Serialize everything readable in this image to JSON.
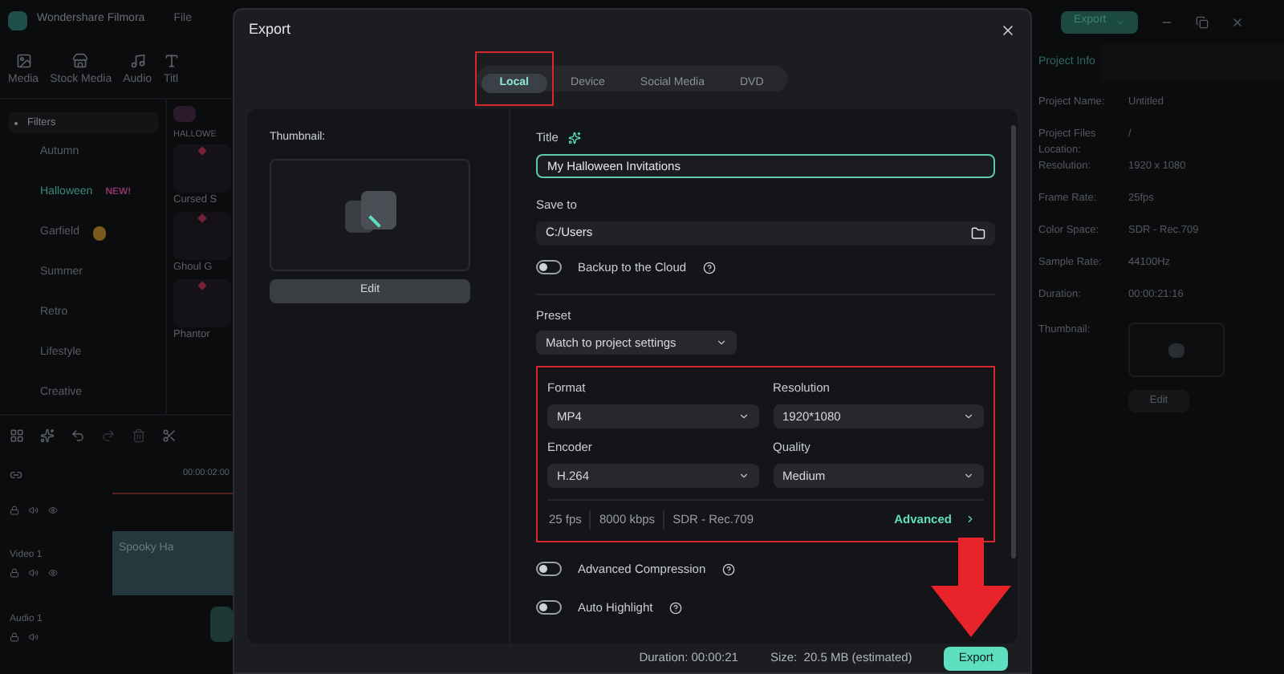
{
  "app": {
    "title": "Wondershare Filmora",
    "menu": [
      "File"
    ],
    "toolbar": [
      {
        "kind": "media",
        "label": "Media"
      },
      {
        "kind": "stock",
        "label": "Stock Media"
      },
      {
        "kind": "audio",
        "label": "Audio"
      },
      {
        "kind": "titles",
        "label": "Titl"
      }
    ],
    "filters": {
      "heading": "Filters",
      "items": [
        {
          "label": "Autumn",
          "selected": false
        },
        {
          "label": "Halloween",
          "selected": true,
          "badge": "NEW!"
        },
        {
          "label": "Garfield",
          "selected": false,
          "sticker": true
        },
        {
          "label": "Summer",
          "selected": false
        },
        {
          "label": "Retro",
          "selected": false
        },
        {
          "label": "Lifestyle",
          "selected": false
        },
        {
          "label": "Creative",
          "selected": false
        }
      ]
    },
    "library": {
      "heading": "HALLOWE",
      "items": [
        "Cursed S",
        "Ghoul G",
        "Phantor"
      ]
    },
    "timeline": {
      "time": "00:00:02:00",
      "tracks": [
        {
          "kind": "video",
          "label": "Video 1",
          "clip": "Spooky Ha"
        },
        {
          "kind": "audio",
          "label": "Audio 1"
        }
      ]
    }
  },
  "header": {
    "export_button": "Export"
  },
  "project_info": {
    "tab": "Project Info",
    "rows": [
      {
        "label": "Project Name:",
        "value": "Untitled"
      },
      {
        "label": "Project Files Location:",
        "value": "/"
      },
      {
        "label": "Resolution:",
        "value": "1920 x 1080"
      },
      {
        "label": "Frame Rate:",
        "value": "25fps"
      },
      {
        "label": "Color Space:",
        "value": "SDR - Rec.709"
      },
      {
        "label": "Sample Rate:",
        "value": "44100Hz"
      },
      {
        "label": "Duration:",
        "value": "00:00:21:16"
      }
    ],
    "thumbnail_label": "Thumbnail:",
    "edit_button": "Edit"
  },
  "dialog": {
    "title": "Export",
    "tabs": [
      {
        "label": "Local",
        "selected": true
      },
      {
        "label": "Device",
        "selected": false
      },
      {
        "label": "Social Media",
        "selected": false
      },
      {
        "label": "DVD",
        "selected": false
      }
    ],
    "thumbnail_label": "Thumbnail:",
    "edit_button": "Edit",
    "title_label": "Title",
    "title_value": "My Halloween Invitations",
    "save_label": "Save to",
    "save_path": "C:/Users",
    "backup": {
      "label": "Backup to the Cloud",
      "on": false
    },
    "preset_label": "Preset",
    "preset_value": "Match to project settings",
    "settings": [
      {
        "label": "Format",
        "value": "MP4"
      },
      {
        "label": "Resolution",
        "value": "1920*1080"
      },
      {
        "label": "Encoder",
        "value": "H.264"
      },
      {
        "label": "Quality",
        "value": "Medium"
      }
    ],
    "stats": [
      "25 fps",
      "8000 kbps",
      "SDR - Rec.709"
    ],
    "advanced_link": "Advanced",
    "toggles": [
      {
        "label": "Advanced Compression",
        "on": false
      },
      {
        "label": "Auto Highlight",
        "on": false
      }
    ],
    "duration": "Duration: 00:00:21",
    "size": "Size:  20.5 MB (estimated)",
    "export_button": "Export"
  }
}
